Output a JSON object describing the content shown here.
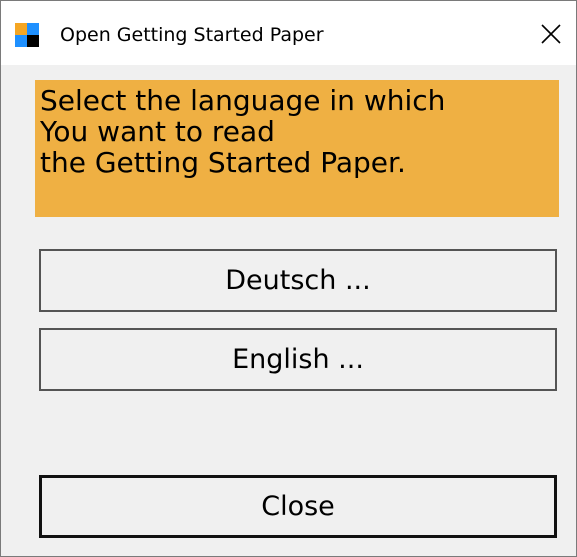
{
  "window": {
    "title": "Open Getting Started Paper",
    "close_icon": "close-icon",
    "app_icon": "app-logo-icon",
    "icon_colors": [
      "#f5a623",
      "#1e90ff",
      "#1e90ff",
      "#000000"
    ]
  },
  "message": {
    "lines": [
      "Select the language in which",
      "You want to read",
      "the Getting Started Paper."
    ],
    "background": "#efb043"
  },
  "buttons": {
    "deutsch": "Deutsch ...",
    "english": "English ...",
    "close": "Close"
  }
}
